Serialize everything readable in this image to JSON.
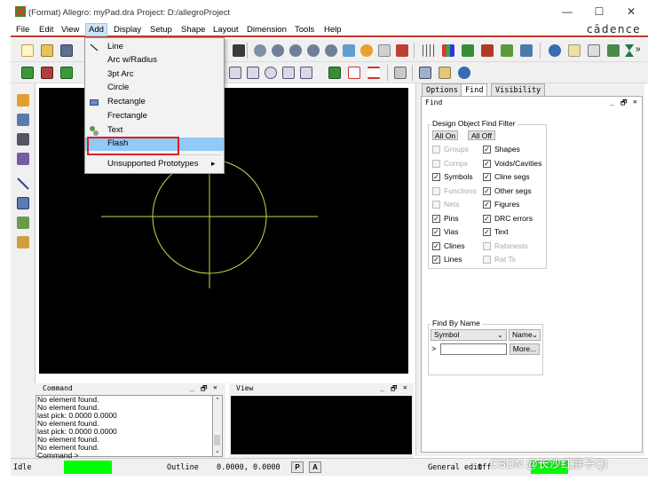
{
  "window": {
    "title": "(Format) Allegro: myPad.dra  Project: D:/allegroProject",
    "controls": [
      "—",
      "☐",
      "✕"
    ]
  },
  "menubar": [
    "File",
    "Edit",
    "View",
    "Add",
    "Display",
    "Setup",
    "Shape",
    "Layout",
    "Dimension",
    "Tools",
    "Help"
  ],
  "brand": "cādence",
  "add_menu": {
    "items": [
      "Line",
      "Arc w/Radius",
      "3pt Arc",
      "Circle",
      "Rectangle",
      "Frectangle",
      "Text",
      "Flash",
      "Unsupported Prototypes"
    ],
    "highlighted": "Flash",
    "submenu_arrow": "▸"
  },
  "tabs": [
    "Options",
    "Find",
    "Visibility"
  ],
  "find_panel": {
    "header": "Find",
    "header_controls": [
      "_",
      "🗗",
      "✕"
    ],
    "filter_title": "Design Object Find Filter",
    "all_on": "All On",
    "all_off": "All Off",
    "left_items": [
      {
        "label": "Groups",
        "checked": false,
        "enabled": false
      },
      {
        "label": "Comps",
        "checked": false,
        "enabled": false
      },
      {
        "label": "Symbols",
        "checked": true,
        "enabled": true
      },
      {
        "label": "Functions",
        "checked": false,
        "enabled": false
      },
      {
        "label": "Nets",
        "checked": false,
        "enabled": false
      },
      {
        "label": "Pins",
        "checked": true,
        "enabled": true
      },
      {
        "label": "Vias",
        "checked": true,
        "enabled": true
      },
      {
        "label": "Clines",
        "checked": true,
        "enabled": true
      },
      {
        "label": "Lines",
        "checked": true,
        "enabled": true
      }
    ],
    "right_items": [
      {
        "label": "Shapes",
        "checked": true,
        "enabled": true
      },
      {
        "label": "Voids/Cavities",
        "checked": true,
        "enabled": true
      },
      {
        "label": "Cline segs",
        "checked": true,
        "enabled": true
      },
      {
        "label": "Other segs",
        "checked": true,
        "enabled": true
      },
      {
        "label": "Figures",
        "checked": true,
        "enabled": true
      },
      {
        "label": "DRC errors",
        "checked": true,
        "enabled": true
      },
      {
        "label": "Text",
        "checked": true,
        "enabled": true
      },
      {
        "label": "Ratsnests",
        "checked": false,
        "enabled": false
      },
      {
        "label": "Rat Ts",
        "checked": false,
        "enabled": false
      }
    ],
    "find_by_name_title": "Find By Name",
    "type_select": "Symbol",
    "mode_select": "Name",
    "name_prompt": ">",
    "name_value": "",
    "more_button": "More..."
  },
  "command_panel": {
    "title": "Command",
    "controls": [
      "_",
      "🗗",
      "✕"
    ],
    "lines": [
      "No element found.",
      "No element found.",
      "last pick:  0.0000 0.0000",
      "No element found.",
      "last pick:  0.0000 0.0000",
      "No element found.",
      "No element found.",
      "Command >"
    ]
  },
  "view_panel": {
    "title": "View",
    "controls": [
      "_",
      "🗗",
      "✕"
    ]
  },
  "statusbar": {
    "state": "Idle",
    "subclass": "Outline",
    "coords": "0.0000, 0.0000",
    "p_button": "P",
    "a_button": "A",
    "mode": "General edit",
    "drc": "Off"
  },
  "watermark": "CSDN @长沙红胖子Qt",
  "colors": {
    "canvas": "#000000",
    "drawing": "#c8d84a",
    "menu_highlight": "#91c9f7",
    "status_green": "#00ff00",
    "annotation_red": "#e02020"
  },
  "icons": {
    "app": "allegro-logo-icon",
    "toolbar_top": [
      "new-file-icon",
      "open-folder-icon",
      "save-icon",
      "zoom-fit-icon",
      "zoom-in-icon",
      "zoom-out-icon",
      "zoom-world-icon",
      "zoom-previous-icon",
      "zoom-center-icon",
      "redraw-icon",
      "3d-view-icon",
      "flip-icon",
      "grid-icon",
      "color-icon",
      "layer-icon",
      "shadow-icon",
      "visibility-icon",
      "info-icon",
      "note-icon",
      "measure-icon",
      "hourglass-icon"
    ]
  }
}
